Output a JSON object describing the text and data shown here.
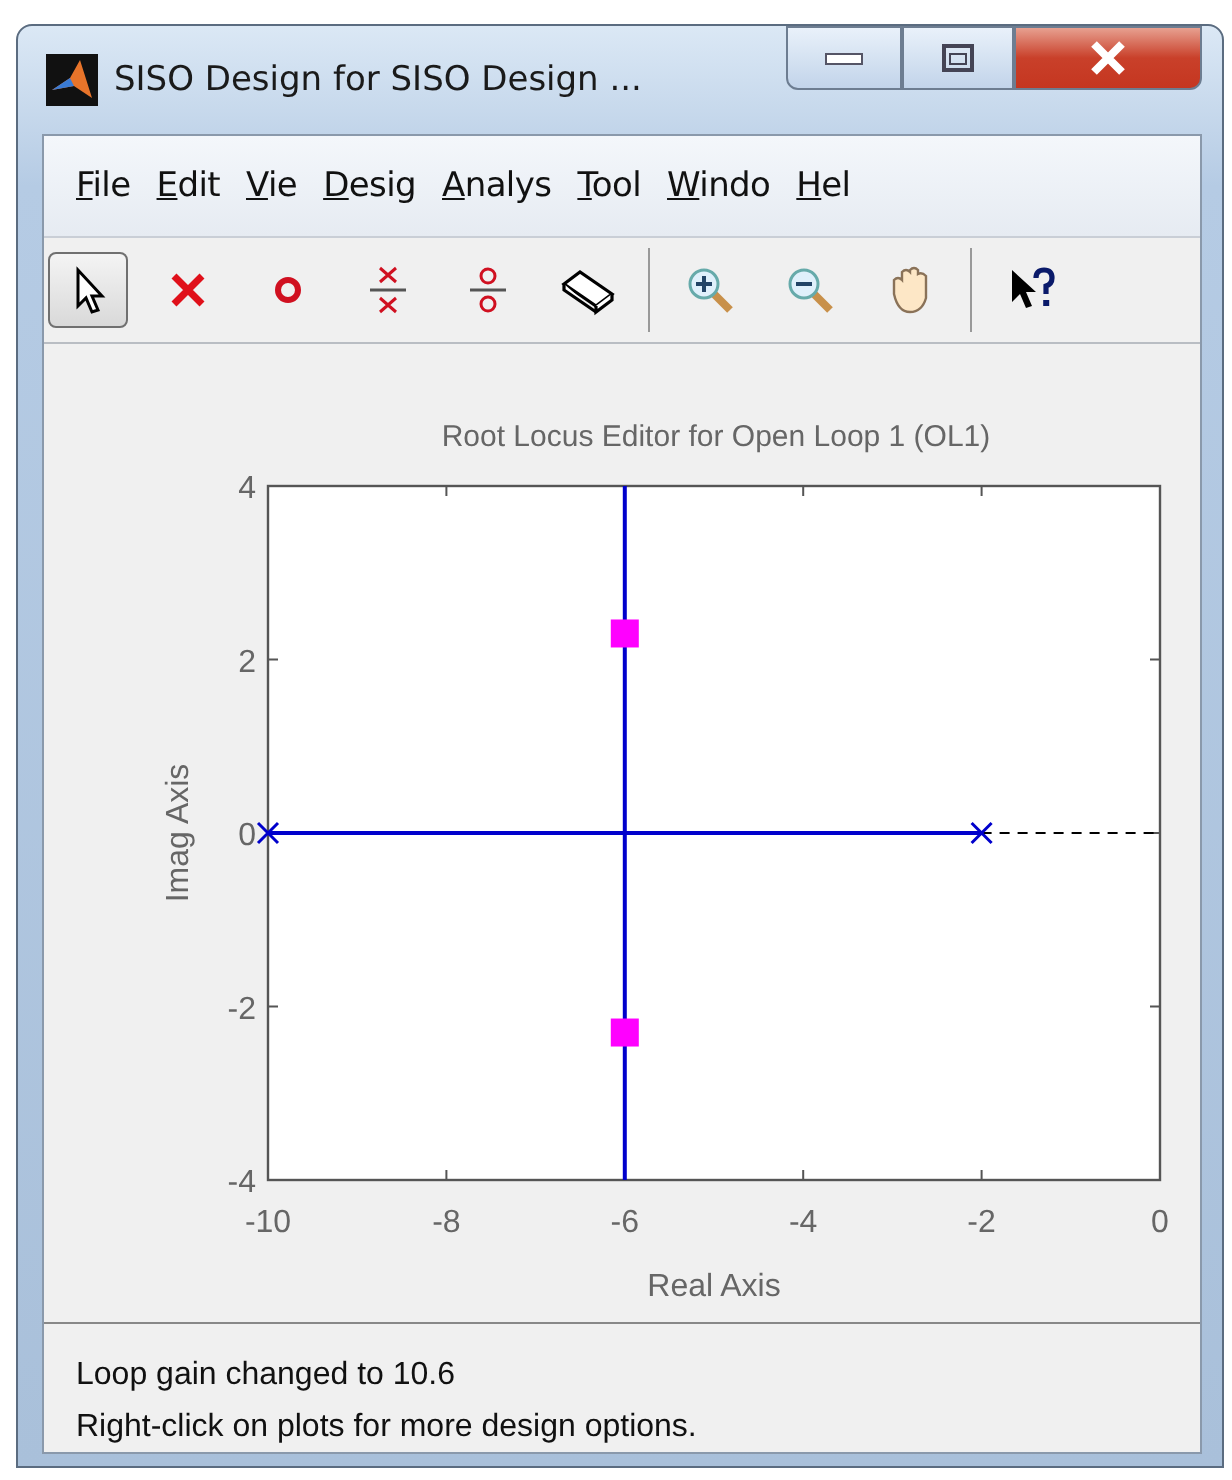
{
  "window": {
    "title": "SISO Design for SISO Design ..."
  },
  "menu": [
    "File",
    "Edit",
    "Vie",
    "Desig",
    "Analys",
    "Tool",
    "Windo",
    "Hel"
  ],
  "toolbar": [
    {
      "kind": "pointer",
      "selected": true
    },
    {
      "kind": "pole",
      "selected": false
    },
    {
      "kind": "zero",
      "selected": false
    },
    {
      "kind": "pole-pair",
      "selected": false
    },
    {
      "kind": "zero-pair",
      "selected": false
    },
    {
      "kind": "eraser",
      "selected": false
    },
    {
      "kind": "separator"
    },
    {
      "kind": "zoom-in",
      "selected": false
    },
    {
      "kind": "zoom-out",
      "selected": false
    },
    {
      "kind": "pan",
      "selected": false
    },
    {
      "kind": "separator"
    },
    {
      "kind": "help",
      "selected": false
    }
  ],
  "plot": {
    "chart_data": {
      "type": "line",
      "title": "Root Locus Editor for Open Loop 1 (OL1)",
      "xlabel": "Real Axis",
      "ylabel": "Imag Axis",
      "xlim": [
        -10,
        0
      ],
      "ylim": [
        -4,
        4
      ],
      "xticks": [
        -10,
        -8,
        -6,
        -4,
        -2,
        0
      ],
      "yticks": [
        -4,
        -2,
        0,
        2,
        4
      ],
      "series": [
        {
          "type": "line",
          "color": "#0000cc",
          "x": [
            -10,
            -2
          ],
          "values": [
            0,
            0
          ]
        },
        {
          "type": "line",
          "color": "#0000cc",
          "x": [
            -6,
            -6
          ],
          "values": [
            -4,
            4
          ]
        },
        {
          "type": "line",
          "line_style": "dashed",
          "color": "#000000",
          "x": [
            -2,
            0
          ],
          "values": [
            0,
            0
          ]
        },
        {
          "type": "scatter",
          "marker": "x",
          "color": "#0000cc",
          "x": [
            -10,
            -2
          ],
          "values": [
            0,
            0
          ]
        },
        {
          "type": "scatter",
          "marker": "square",
          "color": "#ff00ff",
          "x": [
            -6,
            -6
          ],
          "values": [
            2.3,
            -2.3
          ]
        }
      ]
    }
  },
  "status": [
    "Loop gain changed to 10.6",
    "Right-click on plots for more design options."
  ]
}
